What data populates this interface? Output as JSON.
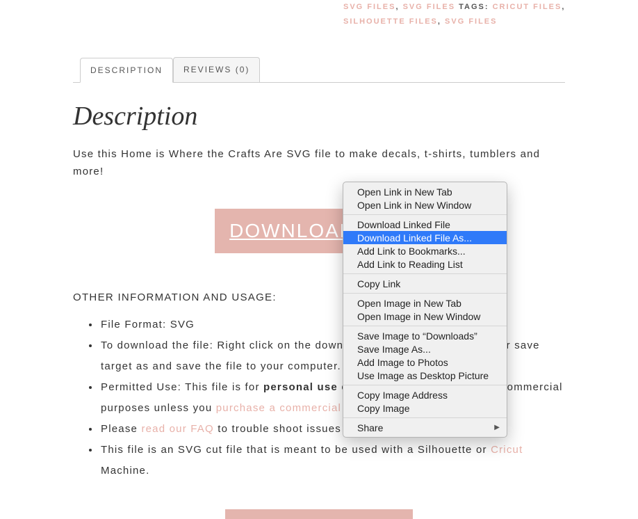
{
  "meta": {
    "link1": "SVG FILES",
    "sep1": ", ",
    "link2": "SVG FILES",
    "tags_label": " TAGS: ",
    "tag1": "CRICUT FILES",
    "tag_sep1": ", ",
    "tag2": "SILHOUETTE FILES",
    "tag_sep2": ", ",
    "tag3": "SVG FILES"
  },
  "tabs": {
    "description": "DESCRIPTION",
    "reviews": "REVIEWS (0)"
  },
  "heading": "Description",
  "intro": "Use this Home is Where the Crafts Are SVG file to make decals, t-shirts, tumblers and more!",
  "download_button": "DOWNLOAD FILE",
  "other_header": "OTHER INFORMATION AND USAGE:",
  "li": {
    "a": "File Format: SVG",
    "b": "To download the file: Right click on the download button and save link as or save target as and save the file to your computer.",
    "c_pre": "Permitted Use: This file is for ",
    "c_bold": "personal use",
    "c_mid": " only. Cannot be used for any commercial purposes unless you ",
    "c_link": "purchase a commercial license",
    "c_post": ".",
    "d_pre": "Please ",
    "d_link": "read our FAQ",
    "d_post": " to trouble shoot issues with download or using files.",
    "e_pre": "This file is an SVG cut file that is meant to be used with a Silhouette or ",
    "e_link": "Cricut",
    "e_post": " Machine."
  },
  "context_menu": {
    "i0": "Open Link in New Tab",
    "i1": "Open Link in New Window",
    "i2": "Download Linked File",
    "i3": "Download Linked File As...",
    "i4": "Add Link to Bookmarks...",
    "i5": "Add Link to Reading List",
    "i6": "Copy Link",
    "i7": "Open Image in New Tab",
    "i8": "Open Image in New Window",
    "i9": "Save Image to “Downloads”",
    "i10": "Save Image As...",
    "i11": "Add Image to Photos",
    "i12": "Use Image as Desktop Picture",
    "i13": "Copy Image Address",
    "i14": "Copy Image",
    "i15": "Share"
  }
}
